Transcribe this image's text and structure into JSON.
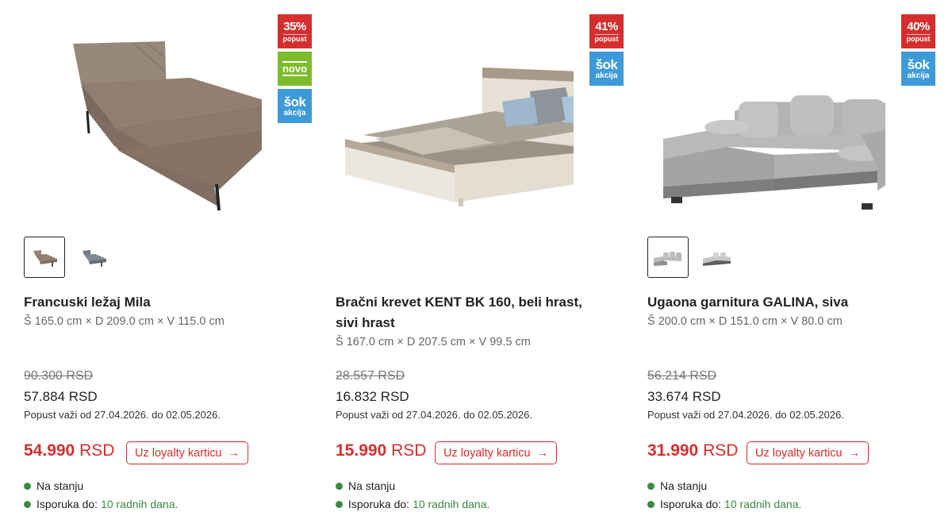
{
  "colors": {
    "discount_red": "#d62e2e",
    "new_green": "#7cbc2a",
    "sok_blue": "#3d9ad8",
    "stock_green": "#3a8a3f"
  },
  "products": [
    {
      "image": "beige-upholstered-bed",
      "badges": {
        "discount_pct": "35%",
        "discount_label": "popust",
        "new_label": "novo",
        "sok_big": "šok",
        "sok_small": "akcija"
      },
      "thumbnails": [
        "beige-bed-thumb",
        "grey-bed-thumb"
      ],
      "title": "Francuski ležaj Mila",
      "dimensions": "Š 165.0 cm × D 209.0 cm × V 115.0 cm",
      "old_price": "90.300 RSD",
      "new_price": "57.884 RSD",
      "promo_dates": "Popust važi od 27.04.2026. do 02.05.2026.",
      "loyalty_amount": "54.990",
      "loyalty_currency": "RSD",
      "loyalty_button": "Uz loyalty karticu",
      "stock": "Na stanju",
      "delivery_label": "Isporuka do:",
      "delivery_days": "10 radnih dana."
    },
    {
      "image": "white-oak-double-bed",
      "badges": {
        "discount_pct": "41%",
        "discount_label": "popust",
        "sok_big": "šok",
        "sok_small": "akcija"
      },
      "title": "Bračni krevet KENT BK 160, beli hrast, sivi hrast",
      "dimensions": "Š 167.0 cm × D 207.5 cm × V 99.5 cm",
      "old_price": "28.557 RSD",
      "new_price": "16.832 RSD",
      "promo_dates": "Popust važi od 27.04.2026. do 02.05.2026.",
      "loyalty_amount": "15.990",
      "loyalty_currency": "RSD",
      "loyalty_button": "Uz loyalty karticu",
      "stock": "Na stanju",
      "delivery_label": "Isporuka do:",
      "delivery_days": "10 radnih dana."
    },
    {
      "image": "grey-corner-sofa",
      "badges": {
        "discount_pct": "40%",
        "discount_label": "popust",
        "sok_big": "šok",
        "sok_small": "akcija"
      },
      "thumbnails": [
        "grey-sofa-thumb",
        "grey-sofa-alt-thumb"
      ],
      "title": "Ugaona garnitura GALINA, siva",
      "dimensions": "Š 200.0 cm × D 151.0 cm × V 80.0 cm",
      "old_price": "56.214 RSD",
      "new_price": "33.674 RSD",
      "promo_dates": "Popust važi od 27.04.2026. do 02.05.2026.",
      "loyalty_amount": "31.990",
      "loyalty_currency": "RSD",
      "loyalty_button": "Uz loyalty karticu",
      "stock": "Na stanju",
      "delivery_label": "Isporuka do:",
      "delivery_days": "10 radnih dana."
    }
  ]
}
